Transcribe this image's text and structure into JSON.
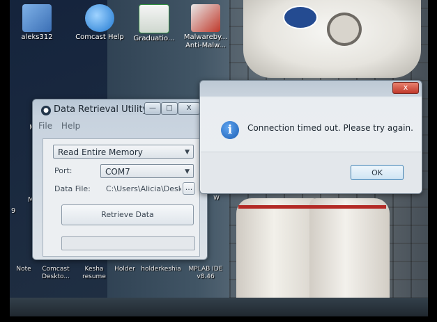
{
  "desktop": {
    "icons_top": [
      {
        "label": "aleks312",
        "icon": "user-folder-icon",
        "color": "#3b6fb5"
      },
      {
        "label": "Comcast Help",
        "icon": "internet-explorer-icon",
        "color": "#1f78d1"
      },
      {
        "label": "Graduatio...",
        "icon": "excel-document-icon",
        "color": "#2e8b3e"
      },
      {
        "label": "Malwareby... Anti-Malw...",
        "icon": "malwarebytes-icon",
        "color": "#c0392b"
      }
    ],
    "left_partial_labels": [
      "M",
      "Mu",
      "9"
    ],
    "icons_bottom": [
      {
        "label": "Note",
        "icon": "shortcut-icon"
      },
      {
        "label": "Comcast Deskto...",
        "icon": "comcast-icon"
      },
      {
        "label": "Kesha resume",
        "icon": "document-icon"
      },
      {
        "label": "Holder",
        "icon": "folder-icon"
      },
      {
        "label": "holderkeshia",
        "icon": "document-icon"
      },
      {
        "label": "MPLAB IDE v8.46",
        "icon": "mplab-icon"
      }
    ],
    "stray_text": "w"
  },
  "data_retrieval_window": {
    "title": "Data Retrieval Utility",
    "controls": {
      "minimize": "—",
      "maximize": "□",
      "close": "X"
    },
    "menu": [
      "File",
      "Help"
    ],
    "mode_select": "Read Entire Memory",
    "port_label": "Port:",
    "port_value": "COM7",
    "data_file_label": "Data File:",
    "data_file_value": "C:\\Users\\Alicia\\Deskt",
    "browse_label": "...",
    "retrieve_button": "Retrieve Data",
    "progress_fraction": 0
  },
  "error_dialog": {
    "title": "",
    "close_label": "x",
    "message": "Connection timed out.  Please try again.",
    "ok_label": "OK",
    "icon": "info-icon"
  },
  "colors": {
    "ok_border": "#3c7fb1",
    "close_red": "#c0392b",
    "info_blue": "#1c5fb4"
  }
}
